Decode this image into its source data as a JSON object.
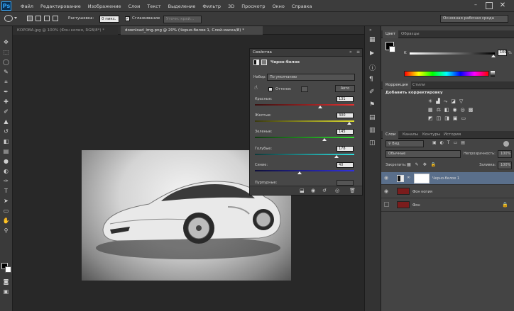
{
  "app": {
    "logo": "Ps"
  },
  "menu": [
    "Файл",
    "Редактирование",
    "Изображение",
    "Слои",
    "Текст",
    "Выделение",
    "Фильтр",
    "3D",
    "Просмотр",
    "Окно",
    "Справка"
  ],
  "options": {
    "feather_label": "Растушевка:",
    "feather_value": "0 пикс.",
    "antialias_label": "Сглаживание",
    "refine_edge": "Уточн. край...",
    "workspace": "Основная рабочая среда"
  },
  "tabs": [
    {
      "label": "КОРОВА.jpg @ 100% (Фон копия, RGB/8*) *",
      "active": false
    },
    {
      "label": "download_img.png @ 20% (Черно-белое 1, Слой-маска/8) *",
      "active": true
    }
  ],
  "properties": {
    "title": "Свойства",
    "subtitle": "Черно-белое",
    "preset_label": "Набор:",
    "preset_value": "По умолчанию",
    "tint_label": "Оттенок",
    "auto_label": "Авто",
    "sliders": [
      {
        "label": "Красные:",
        "value": "131",
        "fraction": 0.66,
        "gradient": "#3a1010,#e03030"
      },
      {
        "label": "Желтые:",
        "value": "300",
        "fraction": 0.95,
        "gradient": "#3a3a10,#e0e030"
      },
      {
        "label": "Зеленые:",
        "value": "145",
        "fraction": 0.7,
        "gradient": "#103a10,#30e030"
      },
      {
        "label": "Голубые:",
        "value": "178",
        "fraction": 0.82,
        "gradient": "#103a3a,#30e0e0"
      },
      {
        "label": "Синие:",
        "value": "40",
        "fraction": 0.45,
        "gradient": "#10103a,#3030e0"
      },
      {
        "label": "Пурпурные:",
        "value": "",
        "fraction": 0.5,
        "gradient": "#3a103a,#e030e0"
      }
    ]
  },
  "color_panel": {
    "tabs": [
      "Цвет",
      "Образцы"
    ],
    "channel": "K",
    "value": "100",
    "unit": "%"
  },
  "adjustments": {
    "tabs": [
      "Коррекция",
      "Стили"
    ],
    "add_label": "Добавить корректировку"
  },
  "layers_panel": {
    "tabs": [
      "Слои",
      "Каналы",
      "Контуры",
      "История"
    ],
    "filter_kind": "Вид",
    "blend_mode": "Обычные",
    "opacity_label": "Непрозрачность:",
    "opacity_value": "100%",
    "lock_label": "Закрепить:",
    "fill_label": "Заливка:",
    "fill_value": "100%",
    "layers": [
      {
        "name": "Черно-белое 1",
        "selected": true
      },
      {
        "name": "Фон копия",
        "selected": false
      },
      {
        "name": "Фон",
        "selected": false
      }
    ]
  }
}
